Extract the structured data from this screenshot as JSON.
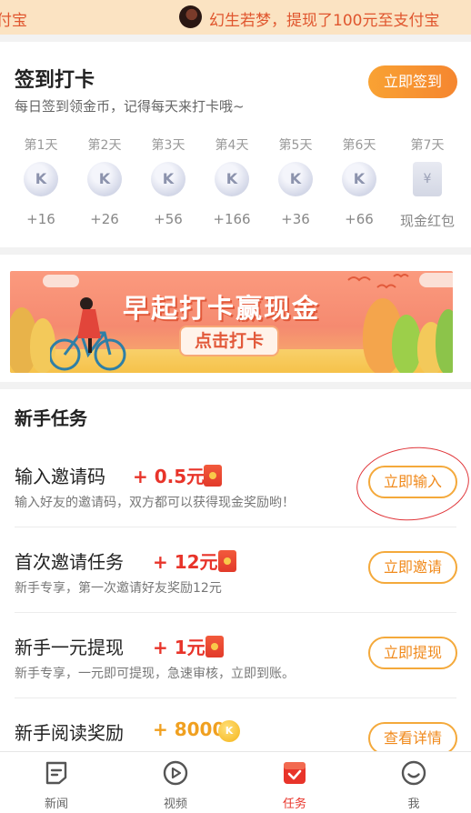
{
  "ticker": {
    "left_fragment": "付宝",
    "message": "幻生若梦，提现了100元至支付宝"
  },
  "checkin": {
    "title": "签到打卡",
    "subtitle": "每日签到领金币，记得每天来打卡哦~",
    "button": "立即签到",
    "days": [
      {
        "label": "第1天",
        "icon": "K",
        "value": "+16"
      },
      {
        "label": "第2天",
        "icon": "K",
        "value": "+26"
      },
      {
        "label": "第3天",
        "icon": "K",
        "value": "+56"
      },
      {
        "label": "第4天",
        "icon": "K",
        "value": "+166"
      },
      {
        "label": "第5天",
        "icon": "K",
        "value": "+36"
      },
      {
        "label": "第6天",
        "icon": "K",
        "value": "+66"
      },
      {
        "label": "第7天",
        "icon": "¥",
        "value": "现金红包"
      }
    ]
  },
  "banner": {
    "headline": "早起打卡赢现金",
    "cta": "点击打卡"
  },
  "tasks": {
    "section_title": "新手任务",
    "items": [
      {
        "name": "输入邀请码",
        "reward": "+ 0.5元",
        "reward_icon": "red-packet-icon",
        "desc": "输入好友的邀请码，双方都可以获得现金奖励哟！",
        "button": "立即输入"
      },
      {
        "name": "首次邀请任务",
        "reward": "+ 12元",
        "reward_icon": "red-packet-icon",
        "desc": "新手专享，第一次邀请好友奖励12元",
        "button": "立即邀请"
      },
      {
        "name": "新手一元提现",
        "reward": "+ 1元",
        "reward_icon": "red-packet-icon",
        "desc": "新手专享，一元即可提现，急速审核，立即到账。",
        "button": "立即提现"
      },
      {
        "name": "新手阅读奖励",
        "reward": "+ 8000",
        "reward_icon": "gold-coin-icon",
        "coin_letter": "K",
        "desc": "",
        "button": "查看详情"
      }
    ]
  },
  "nav": {
    "items": [
      {
        "label": "新闻",
        "icon": "news-icon"
      },
      {
        "label": "视频",
        "icon": "video-icon"
      },
      {
        "label": "任务",
        "icon": "task-icon",
        "active": true
      },
      {
        "label": "我",
        "icon": "profile-icon"
      }
    ]
  },
  "colors": {
    "accent_orange": "#f58630",
    "reward_red": "#e8342a",
    "ticker_bg": "#fbe3c2",
    "ticker_text": "#e0562e"
  }
}
